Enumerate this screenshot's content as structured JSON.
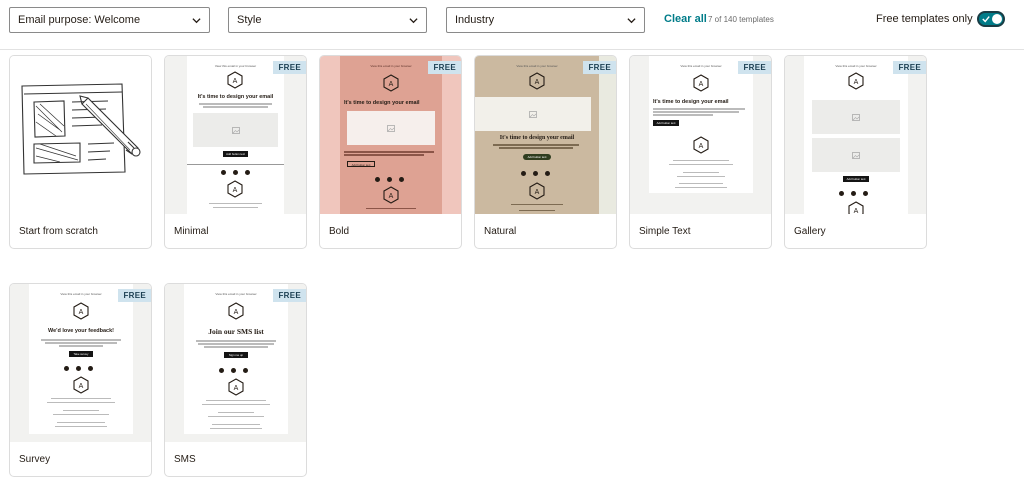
{
  "toolbar": {
    "filters": [
      {
        "label": "Email purpose: Welcome"
      },
      {
        "label": "Style"
      },
      {
        "label": "Industry"
      }
    ],
    "clear_all": "Clear all",
    "count": "7 of 140 templates",
    "free_label": "Free templates only",
    "free_toggle_on": true
  },
  "badge": "FREE",
  "templates": [
    {
      "label": "Start from scratch"
    },
    {
      "label": "Minimal"
    },
    {
      "label": "Bold"
    },
    {
      "label": "Natural"
    },
    {
      "label": "Simple Text"
    },
    {
      "label": "Gallery"
    },
    {
      "label": "Survey"
    },
    {
      "label": "SMS"
    }
  ],
  "preview": {
    "view_in_browser": "View this email in your browser",
    "logo_letter": "A",
    "headline": "It's time to design your email",
    "natural_headline": "It's time to design your email",
    "survey_headline": "We'd love your feedback!",
    "sms_headline": "Join our SMS list",
    "button": "Add button text",
    "survey_button": "Take survey",
    "sms_button": "Sign me up"
  },
  "colors": {
    "accent": "#007c89",
    "badge_bg": "#cfe3ee",
    "bold_bg": "#f0c6bd",
    "bold_doc": "#dea293",
    "natural_bg": "#e9eae0",
    "natural_doc": "#cbb9a0",
    "natural_button": "#2f3d1f"
  }
}
